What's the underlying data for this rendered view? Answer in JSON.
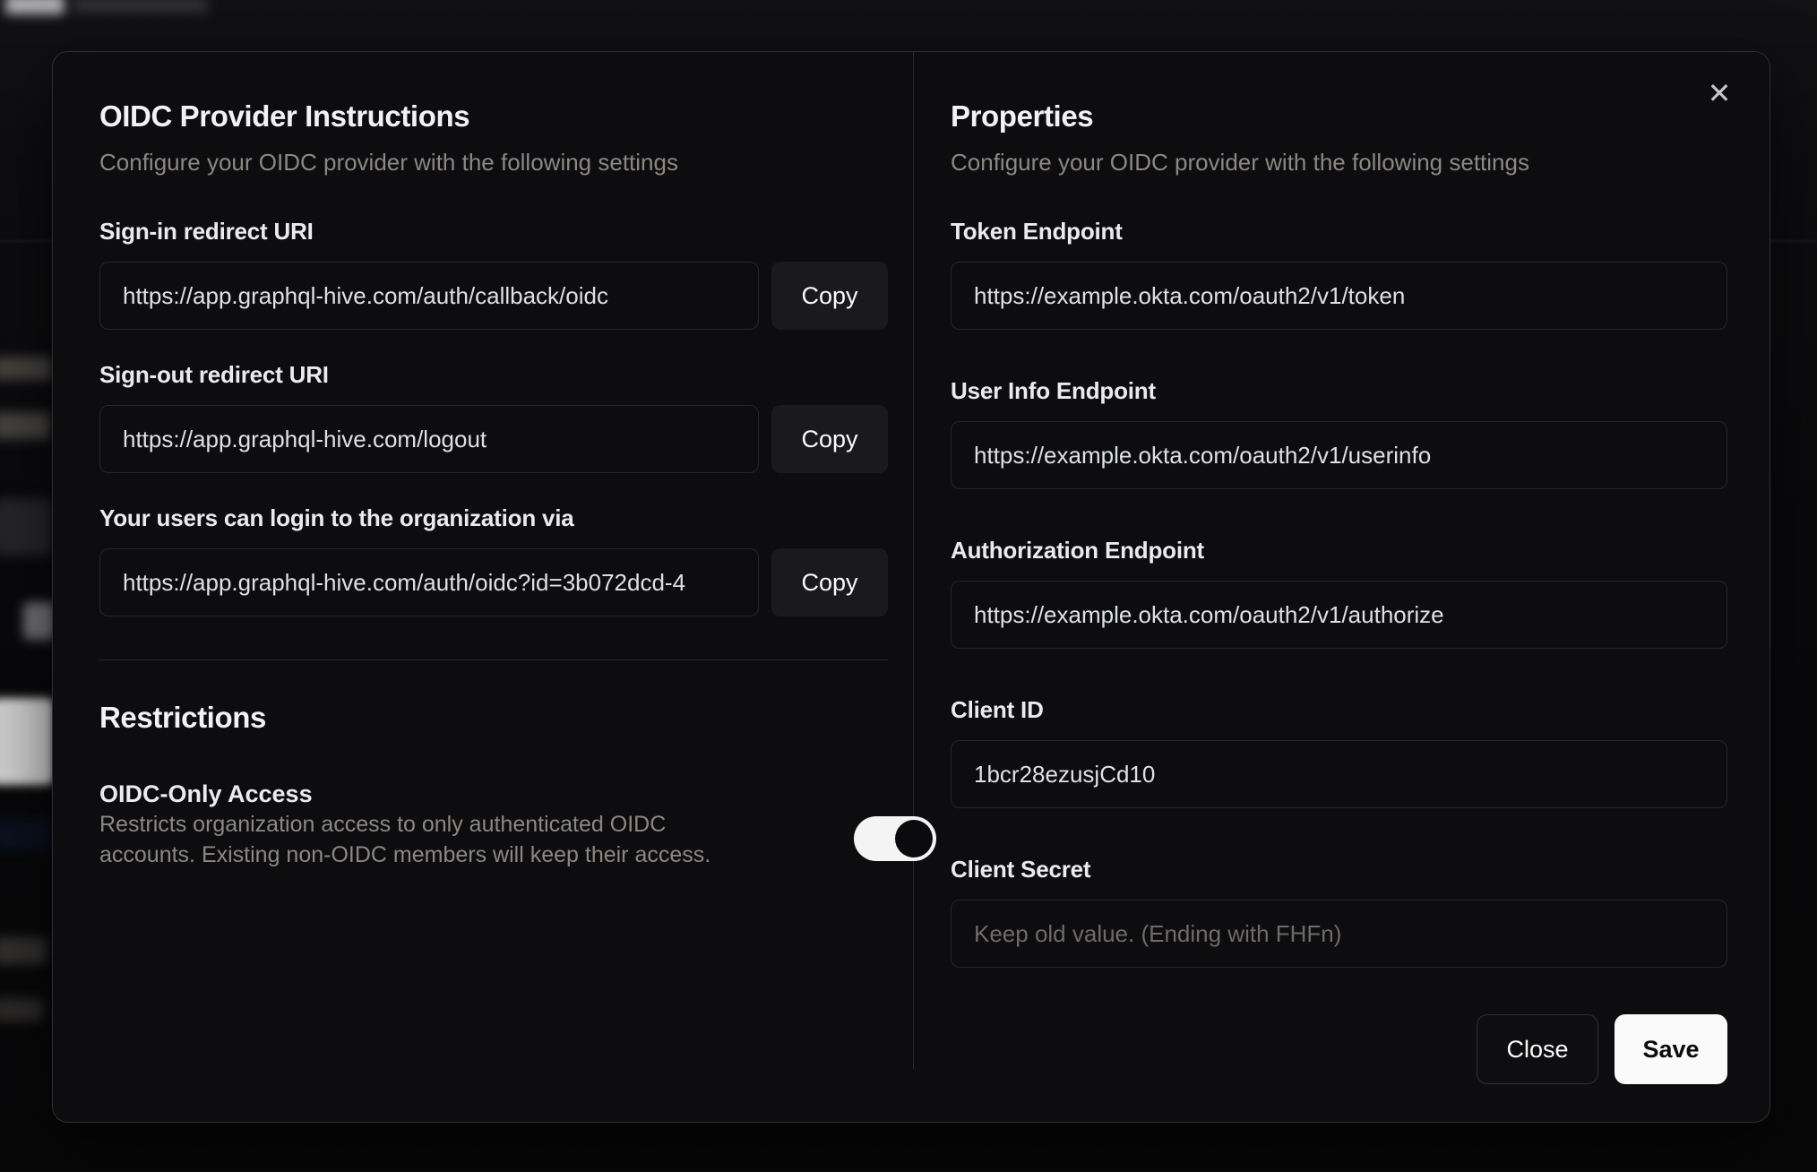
{
  "icons": {
    "close": "✕"
  },
  "colors": {
    "save_button_bg": "#fafafa",
    "toggle_on_track": "#f4f4f5",
    "modal_bg": "#0d0d10"
  },
  "modal": {
    "copy_label": "Copy",
    "left": {
      "title": "OIDC Provider Instructions",
      "subtitle": "Configure your OIDC provider with the following settings",
      "fields": [
        {
          "label": "Sign-in redirect URI",
          "value": "https://app.graphql-hive.com/auth/callback/oidc"
        },
        {
          "label": "Sign-out redirect URI",
          "value": "https://app.graphql-hive.com/logout"
        },
        {
          "label": "Your users can login to the organization via",
          "value": "https://app.graphql-hive.com/auth/oidc?id=3b072dcd-4"
        }
      ],
      "restrictions": {
        "title": "Restrictions",
        "item_label": "OIDC-Only Access",
        "description": "Restricts organization access to only authenticated OIDC accounts. Existing non-OIDC members will keep their access.",
        "toggle_state": "on"
      }
    },
    "right": {
      "title": "Properties",
      "subtitle": "Configure your OIDC provider with the following settings",
      "fields": [
        {
          "label": "Token Endpoint",
          "value": "https://example.okta.com/oauth2/v1/token"
        },
        {
          "label": "User Info Endpoint",
          "value": "https://example.okta.com/oauth2/v1/userinfo"
        },
        {
          "label": "Authorization Endpoint",
          "value": "https://example.okta.com/oauth2/v1/authorize"
        },
        {
          "label": "Client ID",
          "value": "1bcr28ezusjCd10"
        },
        {
          "label": "Client Secret",
          "value": "",
          "placeholder": "Keep old value. (Ending with FHFn)"
        }
      ],
      "footer": {
        "close_label": "Close",
        "save_label": "Save"
      }
    }
  }
}
